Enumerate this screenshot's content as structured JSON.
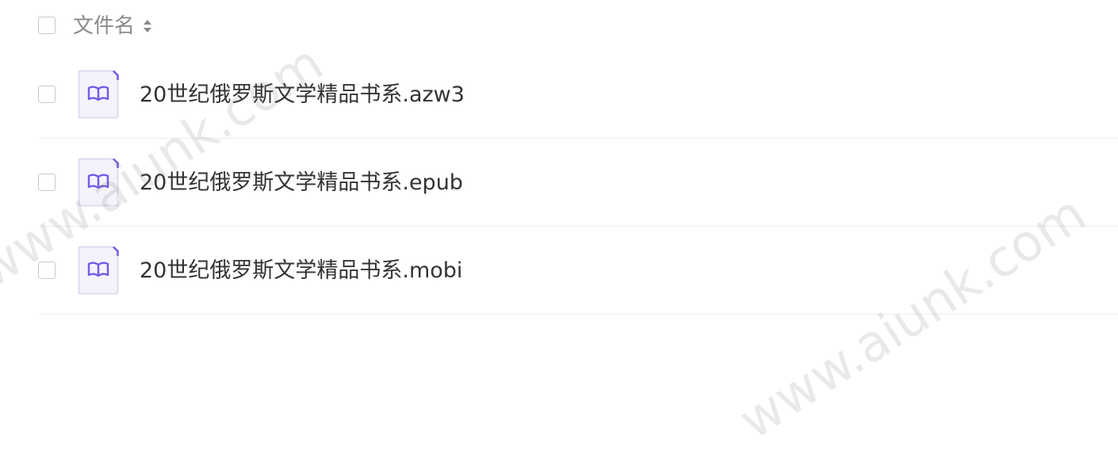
{
  "header": {
    "column_label": "文件名",
    "sort_icon": "sort-icon"
  },
  "files": [
    {
      "name": "20世纪俄罗斯文学精品书系.azw3",
      "icon": "ebook-file-icon"
    },
    {
      "name": "20世纪俄罗斯文学精品书系.epub",
      "icon": "ebook-file-icon"
    },
    {
      "name": "20世纪俄罗斯文学精品书系.mobi",
      "icon": "ebook-file-icon"
    }
  ],
  "watermark": {
    "text": "www.aiunk.com"
  },
  "colors": {
    "icon_accent": "#6e5ce6",
    "icon_background": "#f4f2fb",
    "icon_border": "#d9d4f2",
    "divider": "#ececec",
    "text_primary": "#333333",
    "text_secondary": "#8a8a8a"
  }
}
